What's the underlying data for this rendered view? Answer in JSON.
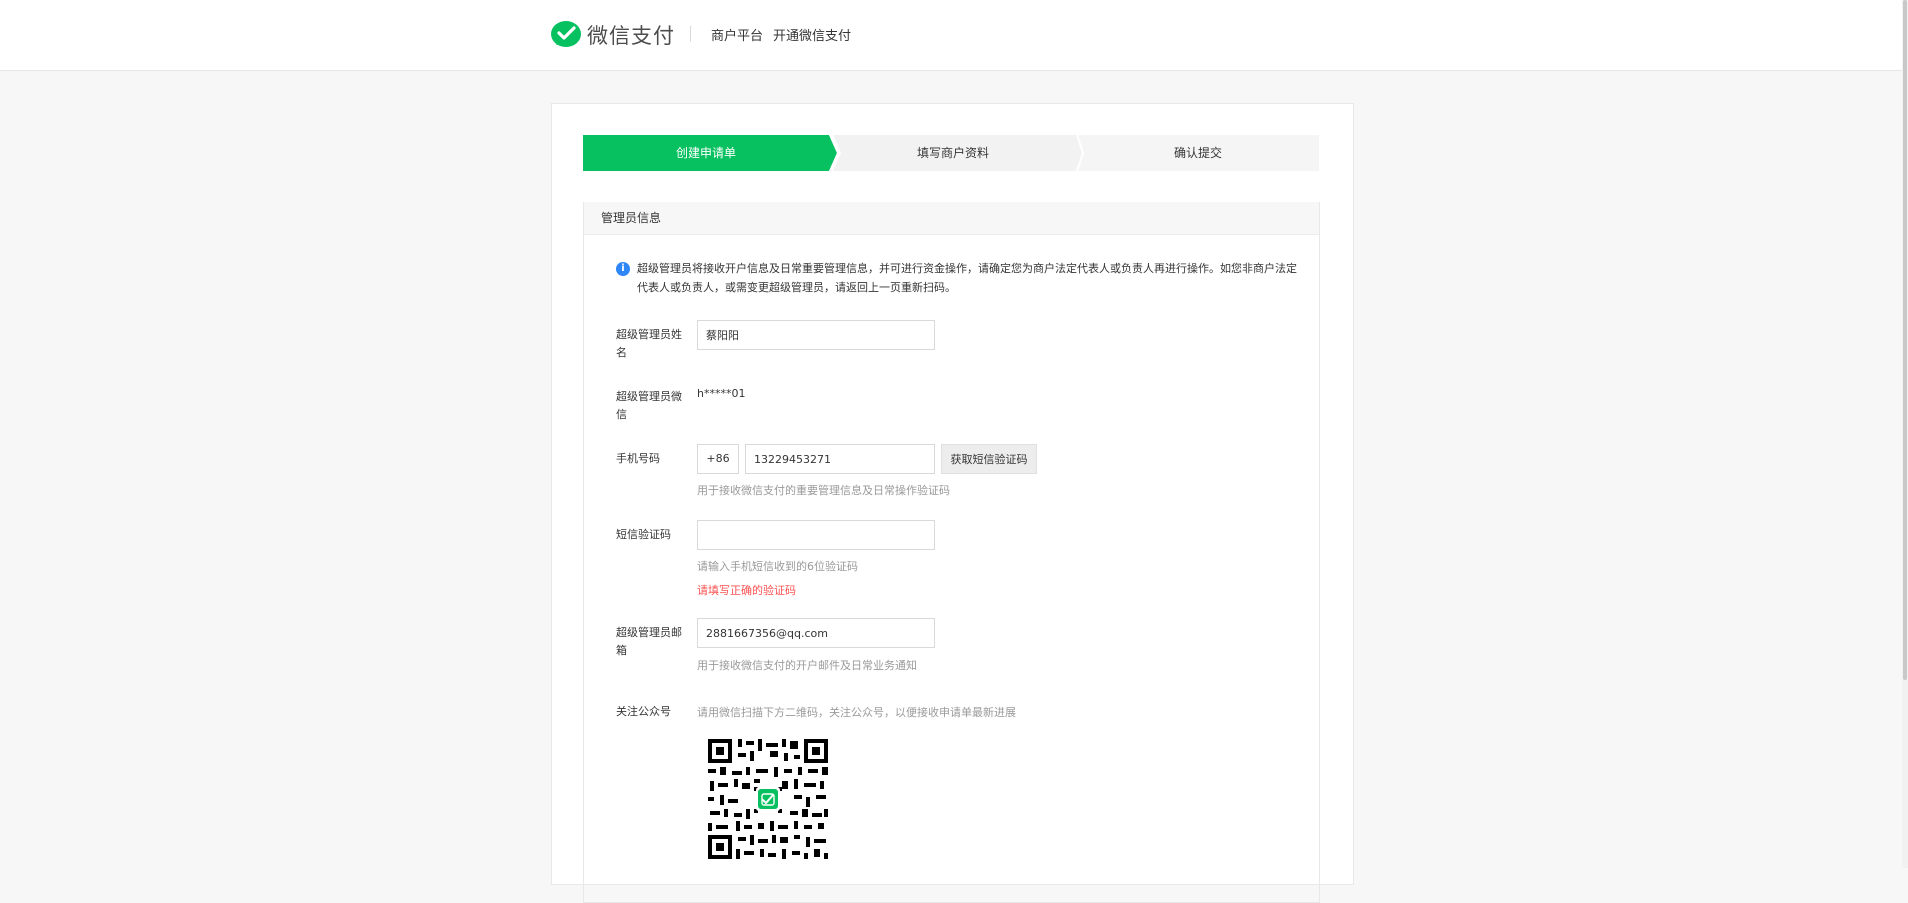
{
  "header": {
    "brand": "微信支付",
    "nav": [
      "商户平台",
      "开通微信支付"
    ]
  },
  "steps": [
    "创建申请单",
    "填写商户资料",
    "确认提交"
  ],
  "panel": {
    "title": "管理员信息",
    "notice": "超级管理员将接收开户信息及日常重要管理信息，并可进行资金操作，请确定您为商户法定代表人或负责人再进行操作。如您非商户法定代表人或负责人，或需变更超级管理员，请返回上一页重新扫码。"
  },
  "form": {
    "name": {
      "label": "超级管理员姓名",
      "value": "蔡阳阳"
    },
    "wechat": {
      "label": "超级管理员微信",
      "value": "h*****01"
    },
    "phone": {
      "label": "手机号码",
      "prefix": "+86",
      "value": "13229453271",
      "button": "获取短信验证码",
      "hint": "用于接收微信支付的重要管理信息及日常操作验证码"
    },
    "sms": {
      "label": "短信验证码",
      "value": "",
      "hint": "请输入手机短信收到的6位验证码",
      "error": "请填写正确的验证码"
    },
    "email": {
      "label": "超级管理员邮箱",
      "value": "2881667356@qq.com",
      "hint": "用于接收微信支付的开户邮件及日常业务通知"
    },
    "follow": {
      "label": "关注公众号",
      "hint": "请用微信扫描下方二维码，关注公众号，以便接收申请单最新进展"
    }
  },
  "colors": {
    "brand_green": "#07c160",
    "error_red": "#fa5151",
    "info_blue": "#2f86f6"
  }
}
